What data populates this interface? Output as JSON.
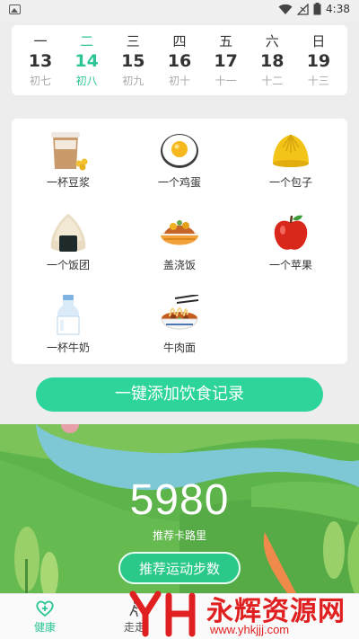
{
  "status_bar": {
    "time": "4:38"
  },
  "calendar": {
    "days": [
      {
        "weekday": "一",
        "date": "13",
        "lunar": "初七"
      },
      {
        "weekday": "二",
        "date": "14",
        "lunar": "初八"
      },
      {
        "weekday": "三",
        "date": "15",
        "lunar": "初九"
      },
      {
        "weekday": "四",
        "date": "16",
        "lunar": "初十"
      },
      {
        "weekday": "五",
        "date": "17",
        "lunar": "十一"
      },
      {
        "weekday": "六",
        "date": "18",
        "lunar": "十二"
      },
      {
        "weekday": "日",
        "date": "19",
        "lunar": "十三"
      }
    ],
    "selected_index": 1
  },
  "foods": [
    {
      "label": "一杯豆浆",
      "icon": "soy-milk-icon"
    },
    {
      "label": "一个鸡蛋",
      "icon": "egg-icon"
    },
    {
      "label": "一个包子",
      "icon": "steamed-bun-icon"
    },
    {
      "label": "一个饭团",
      "icon": "rice-ball-icon"
    },
    {
      "label": "盖浇饭",
      "icon": "rice-bowl-icon"
    },
    {
      "label": "一个苹果",
      "icon": "apple-icon"
    },
    {
      "label": "一杯牛奶",
      "icon": "milk-bottle-icon"
    },
    {
      "label": "牛肉面",
      "icon": "beef-noodles-icon"
    }
  ],
  "add_record_button": "一键添加饮食记录",
  "health": {
    "value": "5980",
    "value_label": "推荐卡路里",
    "recommend_button": "推荐运动步数"
  },
  "tabbar": {
    "tabs": [
      {
        "label": "健康",
        "icon": "health-heart-icon"
      },
      {
        "label": "走走",
        "icon": "walk-icon"
      }
    ]
  },
  "watermark": {
    "name": "永辉资源网",
    "url": "www.yhkjjj.com"
  },
  "colors": {
    "accent": "#2dc596",
    "button": "#2dd59a",
    "grass": "#5db44a"
  }
}
